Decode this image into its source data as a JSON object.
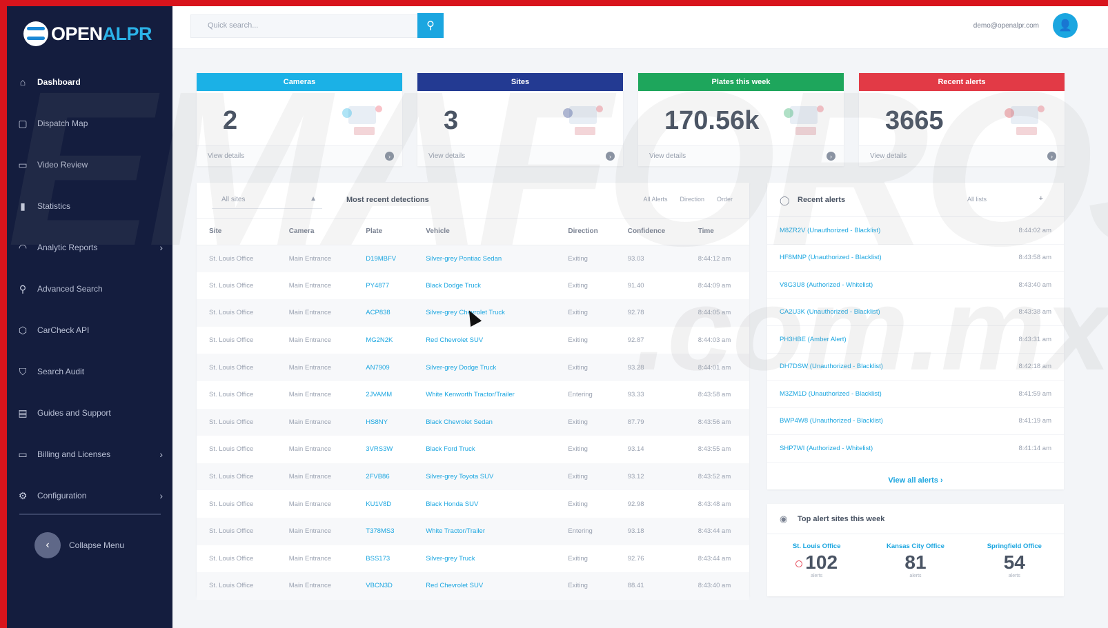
{
  "brand": {
    "logo_open": "OPEN",
    "logo_alpr": "ALPR"
  },
  "sidebar": {
    "items": [
      {
        "label": "Dashboard",
        "icon": "home-icon",
        "glyph": "⌂"
      },
      {
        "label": "Dispatch Map",
        "icon": "map-icon",
        "glyph": "▢"
      },
      {
        "label": "Video Review",
        "icon": "video-icon",
        "glyph": "▭"
      },
      {
        "label": "Statistics",
        "icon": "bar-chart-icon",
        "glyph": "▮"
      },
      {
        "label": "Analytic Reports",
        "icon": "gauge-icon",
        "glyph": "◠"
      },
      {
        "label": "Advanced Search",
        "icon": "search-icon",
        "glyph": "⚲"
      },
      {
        "label": "CarCheck API",
        "icon": "box-icon",
        "glyph": "⬡"
      },
      {
        "label": "Search Audit",
        "icon": "shield-icon",
        "glyph": "⛉"
      },
      {
        "label": "Guides and Support",
        "icon": "book-icon",
        "glyph": "▤"
      },
      {
        "label": "Billing and Licenses",
        "icon": "card-icon",
        "glyph": "▭"
      },
      {
        "label": "Configuration",
        "icon": "gear-icon",
        "glyph": "⚙"
      }
    ],
    "collapse_label": "Collapse Menu"
  },
  "topbar": {
    "search_placeholder": "Quick search...",
    "user_email": "demo@openalpr.com"
  },
  "cards": [
    {
      "title": "Cameras",
      "value": "2",
      "footer": "View details",
      "color": "#1bb1e6"
    },
    {
      "title": "Sites",
      "value": "3",
      "footer": "View details",
      "color": "#233a92"
    },
    {
      "title": "Plates this week",
      "value": "170.56k",
      "footer": "View details",
      "color": "#1ea65c"
    },
    {
      "title": "Recent alerts",
      "value": "3665",
      "footer": "View details",
      "color": "#e23a46"
    }
  ],
  "detections": {
    "site_select": "All sites",
    "title": "Most recent detections",
    "filters": [
      "All Alerts",
      "Direction",
      "Order"
    ],
    "columns": [
      "Site",
      "Camera",
      "Plate",
      "Vehicle",
      "Direction",
      "Confidence",
      "Time"
    ],
    "rows": [
      [
        "St. Louis Office",
        "Main Entrance",
        "D19MBFV",
        "Silver-grey Pontiac Sedan",
        "Exiting",
        "93.03",
        "8:44:12 am"
      ],
      [
        "St. Louis Office",
        "Main Entrance",
        "PY4877",
        "Black Dodge Truck",
        "Exiting",
        "91.40",
        "8:44:09 am"
      ],
      [
        "St. Louis Office",
        "Main Entrance",
        "ACP838",
        "Silver-grey Chevrolet Truck",
        "Exiting",
        "92.78",
        "8:44:05 am"
      ],
      [
        "St. Louis Office",
        "Main Entrance",
        "MG2N2K",
        "Red Chevrolet SUV",
        "Exiting",
        "92.87",
        "8:44:03 am"
      ],
      [
        "St. Louis Office",
        "Main Entrance",
        "AN7909",
        "Silver-grey Dodge Truck",
        "Exiting",
        "93.28",
        "8:44:01 am"
      ],
      [
        "St. Louis Office",
        "Main Entrance",
        "2JVAMM",
        "White Kenworth Tractor/Trailer",
        "Entering",
        "93.33",
        "8:43:58 am"
      ],
      [
        "St. Louis Office",
        "Main Entrance",
        "HS8NY",
        "Black Chevrolet Sedan",
        "Exiting",
        "87.79",
        "8:43:56 am"
      ],
      [
        "St. Louis Office",
        "Main Entrance",
        "3VRS3W",
        "Black Ford Truck",
        "Exiting",
        "93.14",
        "8:43:55 am"
      ],
      [
        "St. Louis Office",
        "Main Entrance",
        "2FVB86",
        "Silver-grey Toyota SUV",
        "Exiting",
        "93.12",
        "8:43:52 am"
      ],
      [
        "St. Louis Office",
        "Main Entrance",
        "KU1V8D",
        "Black Honda SUV",
        "Exiting",
        "92.98",
        "8:43:48 am"
      ],
      [
        "St. Louis Office",
        "Main Entrance",
        "T378MS3",
        "White Tractor/Trailer",
        "Entering",
        "93.18",
        "8:43:44 am"
      ],
      [
        "St. Louis Office",
        "Main Entrance",
        "BSS173",
        "Silver-grey Truck",
        "Exiting",
        "92.76",
        "8:43:44 am"
      ],
      [
        "St. Louis Office",
        "Main Entrance",
        "VBCN3D",
        "Red Chevrolet SUV",
        "Exiting",
        "88.41",
        "8:43:40 am"
      ]
    ]
  },
  "alerts": {
    "title": "Recent alerts",
    "select": "All lists",
    "rows": [
      {
        "text": "M8ZR2V (Unauthorized - Blacklist)",
        "time": "8:44:02 am"
      },
      {
        "text": "HF8MNP (Unauthorized - Blacklist)",
        "time": "8:43:58 am"
      },
      {
        "text": "V8G3U8 (Authorized - Whitelist)",
        "time": "8:43:40 am"
      },
      {
        "text": "CA2U3K (Unauthorized - Blacklist)",
        "time": "8:43:38 am"
      },
      {
        "text": "PH3HBE (Amber Alert)",
        "time": "8:43:31 am"
      },
      {
        "text": "DH7DSW (Unauthorized - Blacklist)",
        "time": "8:42:18 am"
      },
      {
        "text": "M3ZM1D (Unauthorized - Blacklist)",
        "time": "8:41:59 am"
      },
      {
        "text": "BWP4W8 (Unauthorized - Blacklist)",
        "time": "8:41:19 am"
      },
      {
        "text": "SHP7WI (Authorized - Whitelist)",
        "time": "8:41:14 am"
      }
    ],
    "view_all": "View all alerts ›"
  },
  "top_sites": {
    "title": "Top alert sites this week",
    "sites": [
      {
        "name": "St. Louis Office",
        "count": "102",
        "unit": "alerts"
      },
      {
        "name": "Kansas City Office",
        "count": "81",
        "unit": "alerts"
      },
      {
        "name": "Springfield Office",
        "count": "54",
        "unit": "alerts"
      }
    ]
  },
  "watermark": {
    "line1": "EMAFOROS",
    "line2": ".com.mx"
  }
}
